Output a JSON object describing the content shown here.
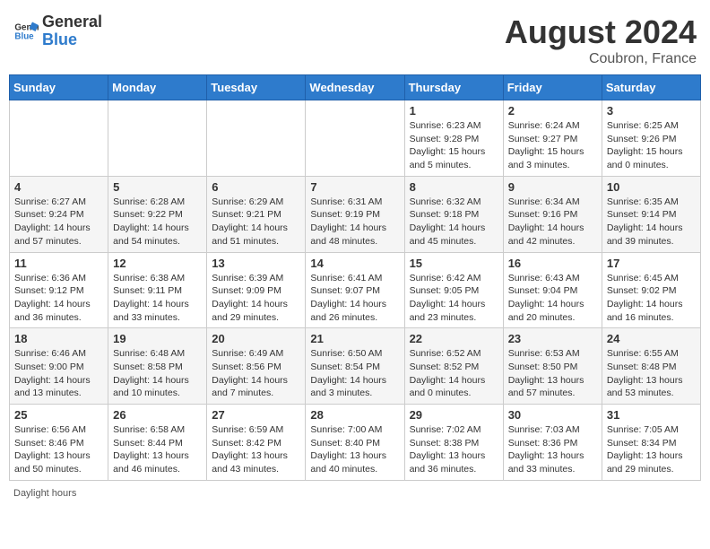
{
  "header": {
    "logo_general": "General",
    "logo_blue": "Blue",
    "title": "August 2024",
    "location": "Coubron, France"
  },
  "days_of_week": [
    "Sunday",
    "Monday",
    "Tuesday",
    "Wednesday",
    "Thursday",
    "Friday",
    "Saturday"
  ],
  "weeks": [
    [
      {
        "day": "",
        "info": ""
      },
      {
        "day": "",
        "info": ""
      },
      {
        "day": "",
        "info": ""
      },
      {
        "day": "",
        "info": ""
      },
      {
        "day": "1",
        "info": "Sunrise: 6:23 AM\nSunset: 9:28 PM\nDaylight: 15 hours\nand 5 minutes."
      },
      {
        "day": "2",
        "info": "Sunrise: 6:24 AM\nSunset: 9:27 PM\nDaylight: 15 hours\nand 3 minutes."
      },
      {
        "day": "3",
        "info": "Sunrise: 6:25 AM\nSunset: 9:26 PM\nDaylight: 15 hours\nand 0 minutes."
      }
    ],
    [
      {
        "day": "4",
        "info": "Sunrise: 6:27 AM\nSunset: 9:24 PM\nDaylight: 14 hours\nand 57 minutes."
      },
      {
        "day": "5",
        "info": "Sunrise: 6:28 AM\nSunset: 9:22 PM\nDaylight: 14 hours\nand 54 minutes."
      },
      {
        "day": "6",
        "info": "Sunrise: 6:29 AM\nSunset: 9:21 PM\nDaylight: 14 hours\nand 51 minutes."
      },
      {
        "day": "7",
        "info": "Sunrise: 6:31 AM\nSunset: 9:19 PM\nDaylight: 14 hours\nand 48 minutes."
      },
      {
        "day": "8",
        "info": "Sunrise: 6:32 AM\nSunset: 9:18 PM\nDaylight: 14 hours\nand 45 minutes."
      },
      {
        "day": "9",
        "info": "Sunrise: 6:34 AM\nSunset: 9:16 PM\nDaylight: 14 hours\nand 42 minutes."
      },
      {
        "day": "10",
        "info": "Sunrise: 6:35 AM\nSunset: 9:14 PM\nDaylight: 14 hours\nand 39 minutes."
      }
    ],
    [
      {
        "day": "11",
        "info": "Sunrise: 6:36 AM\nSunset: 9:12 PM\nDaylight: 14 hours\nand 36 minutes."
      },
      {
        "day": "12",
        "info": "Sunrise: 6:38 AM\nSunset: 9:11 PM\nDaylight: 14 hours\nand 33 minutes."
      },
      {
        "day": "13",
        "info": "Sunrise: 6:39 AM\nSunset: 9:09 PM\nDaylight: 14 hours\nand 29 minutes."
      },
      {
        "day": "14",
        "info": "Sunrise: 6:41 AM\nSunset: 9:07 PM\nDaylight: 14 hours\nand 26 minutes."
      },
      {
        "day": "15",
        "info": "Sunrise: 6:42 AM\nSunset: 9:05 PM\nDaylight: 14 hours\nand 23 minutes."
      },
      {
        "day": "16",
        "info": "Sunrise: 6:43 AM\nSunset: 9:04 PM\nDaylight: 14 hours\nand 20 minutes."
      },
      {
        "day": "17",
        "info": "Sunrise: 6:45 AM\nSunset: 9:02 PM\nDaylight: 14 hours\nand 16 minutes."
      }
    ],
    [
      {
        "day": "18",
        "info": "Sunrise: 6:46 AM\nSunset: 9:00 PM\nDaylight: 14 hours\nand 13 minutes."
      },
      {
        "day": "19",
        "info": "Sunrise: 6:48 AM\nSunset: 8:58 PM\nDaylight: 14 hours\nand 10 minutes."
      },
      {
        "day": "20",
        "info": "Sunrise: 6:49 AM\nSunset: 8:56 PM\nDaylight: 14 hours\nand 7 minutes."
      },
      {
        "day": "21",
        "info": "Sunrise: 6:50 AM\nSunset: 8:54 PM\nDaylight: 14 hours\nand 3 minutes."
      },
      {
        "day": "22",
        "info": "Sunrise: 6:52 AM\nSunset: 8:52 PM\nDaylight: 14 hours\nand 0 minutes."
      },
      {
        "day": "23",
        "info": "Sunrise: 6:53 AM\nSunset: 8:50 PM\nDaylight: 13 hours\nand 57 minutes."
      },
      {
        "day": "24",
        "info": "Sunrise: 6:55 AM\nSunset: 8:48 PM\nDaylight: 13 hours\nand 53 minutes."
      }
    ],
    [
      {
        "day": "25",
        "info": "Sunrise: 6:56 AM\nSunset: 8:46 PM\nDaylight: 13 hours\nand 50 minutes."
      },
      {
        "day": "26",
        "info": "Sunrise: 6:58 AM\nSunset: 8:44 PM\nDaylight: 13 hours\nand 46 minutes."
      },
      {
        "day": "27",
        "info": "Sunrise: 6:59 AM\nSunset: 8:42 PM\nDaylight: 13 hours\nand 43 minutes."
      },
      {
        "day": "28",
        "info": "Sunrise: 7:00 AM\nSunset: 8:40 PM\nDaylight: 13 hours\nand 40 minutes."
      },
      {
        "day": "29",
        "info": "Sunrise: 7:02 AM\nSunset: 8:38 PM\nDaylight: 13 hours\nand 36 minutes."
      },
      {
        "day": "30",
        "info": "Sunrise: 7:03 AM\nSunset: 8:36 PM\nDaylight: 13 hours\nand 33 minutes."
      },
      {
        "day": "31",
        "info": "Sunrise: 7:05 AM\nSunset: 8:34 PM\nDaylight: 13 hours\nand 29 minutes."
      }
    ]
  ],
  "footer": {
    "daylight_label": "Daylight hours"
  }
}
